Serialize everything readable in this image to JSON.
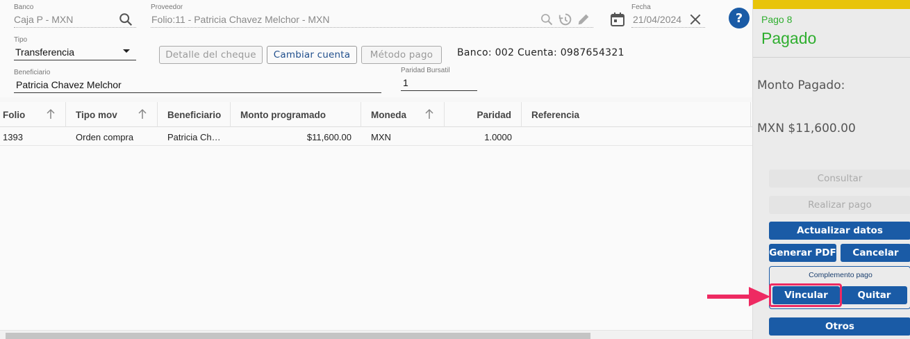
{
  "form": {
    "banco": {
      "label": "Banco",
      "value": "Caja P - MXN"
    },
    "proveedor": {
      "label": "Proveedor",
      "value": "Folio:11 - Patricia Chavez Melchor - MXN"
    },
    "fecha": {
      "label": "Fecha",
      "value": "21/04/2024"
    },
    "tipo": {
      "label": "Tipo",
      "value": "Transferencia"
    },
    "beneficiario": {
      "label": "Beneficiario",
      "value": "Patricia Chavez Melchor"
    },
    "paridad": {
      "label": "Paridad Bursatil",
      "value": "1"
    },
    "buttons": {
      "detalle": "Detalle del cheque",
      "cambiar": "Cambiar cuenta",
      "metodo": "Método pago"
    },
    "bank_info": "Banco: 002 Cuenta: 0987654321"
  },
  "help_label": "?",
  "grid": {
    "columns": [
      "Folio",
      "Tipo mov",
      "Beneficiario",
      "Monto programado",
      "Moneda",
      "Paridad",
      "Referencia"
    ],
    "rows": [
      {
        "folio": "1393",
        "tipo_mov": "Orden compra",
        "beneficiario": "Patricia Ch…",
        "monto": "$11,600.00",
        "moneda": "MXN",
        "paridad": "1.0000",
        "referencia": ""
      }
    ]
  },
  "panel": {
    "pago_num": "Pago 8",
    "status": "Pagado",
    "monto_label": "Monto Pagado:",
    "monto_value": "MXN $11,600.00",
    "consultar": "Consultar",
    "realizar": "Realizar pago",
    "actualizar": "Actualizar datos",
    "generar_pdf": "Generar PDF",
    "cancelar": "Cancelar",
    "complemento_label": "Complemento pago",
    "vincular": "Vincular",
    "quitar": "Quitar",
    "otros": "Otros"
  },
  "colors": {
    "accent_blue": "#1a5ba6",
    "status_green": "#2fae2f",
    "top_bar": "#e8c40a",
    "highlight": "#ee2a62"
  }
}
